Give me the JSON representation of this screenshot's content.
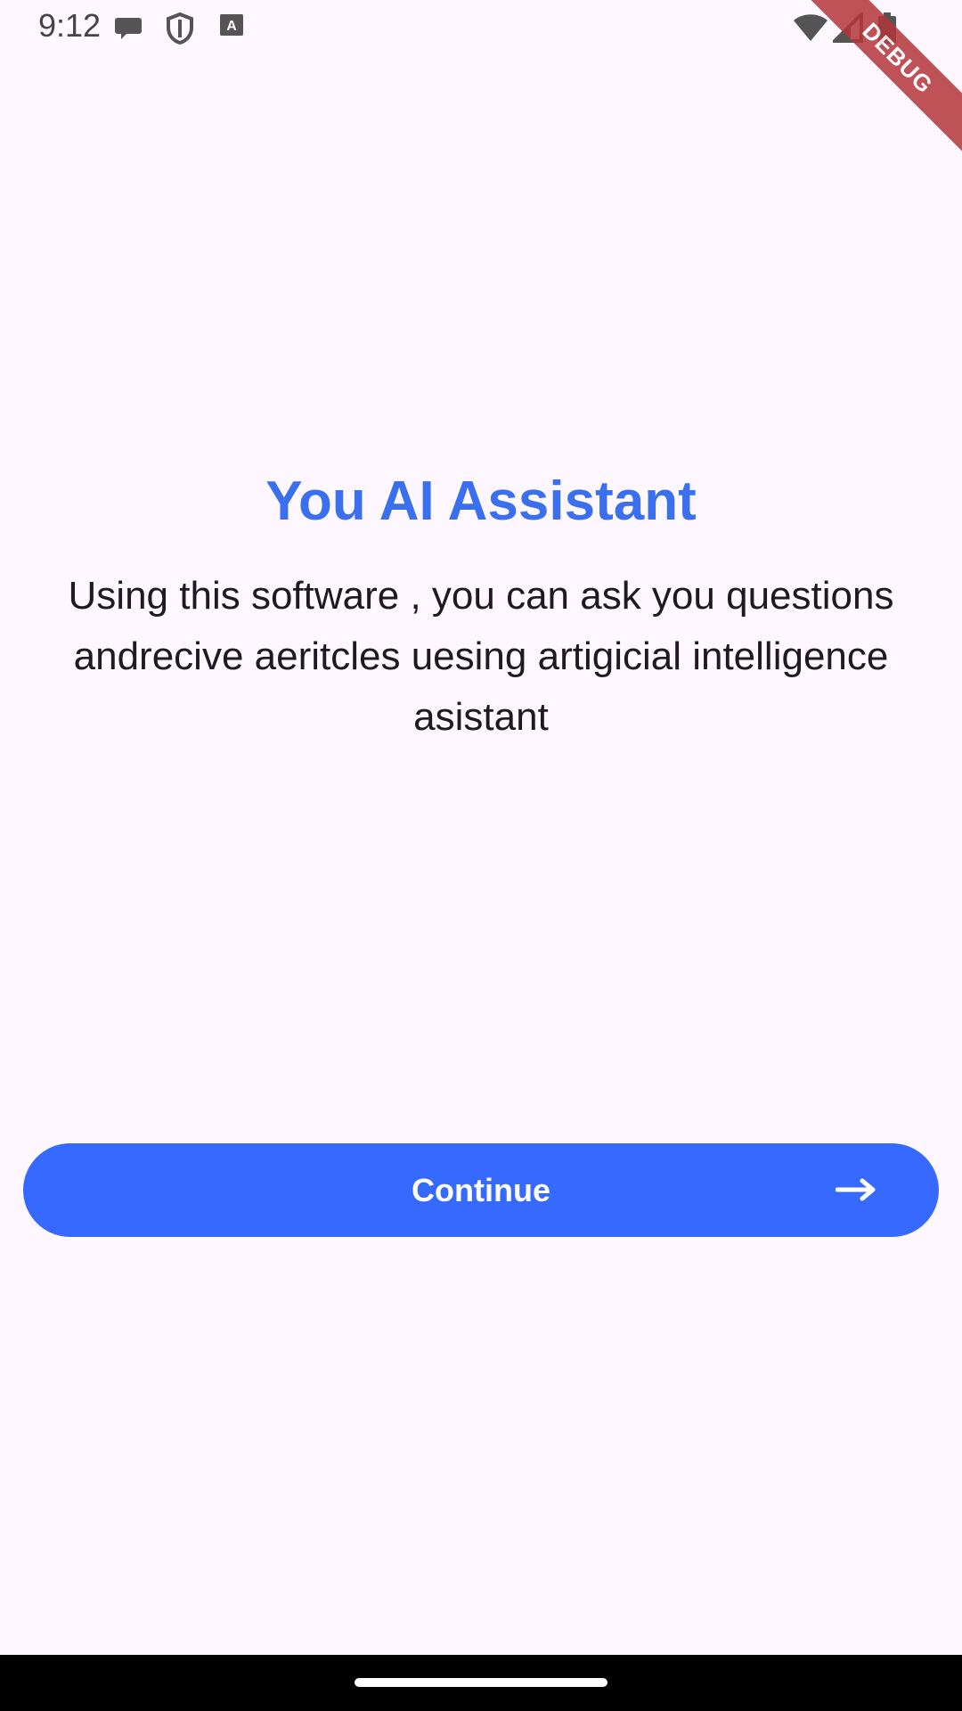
{
  "status_bar": {
    "time": "9:12",
    "icons": [
      "chat-bubble-icon",
      "shield-icon",
      "keyboard-a-icon",
      "wifi-icon",
      "signal-icon",
      "battery-icon"
    ]
  },
  "debug_banner": {
    "label": "DEBUG"
  },
  "main": {
    "title": "You AI Assistant",
    "description": "Using this software , you can ask you questions andrecive aeritcles uesing artigicial intelligence asistant",
    "continue_label": "Continue",
    "continue_icon": "arrow-right-icon"
  },
  "colors": {
    "background": "#FEF7FF",
    "accent": "#3669FF",
    "title": "#3A6FF0",
    "text": "#1D1B20"
  }
}
